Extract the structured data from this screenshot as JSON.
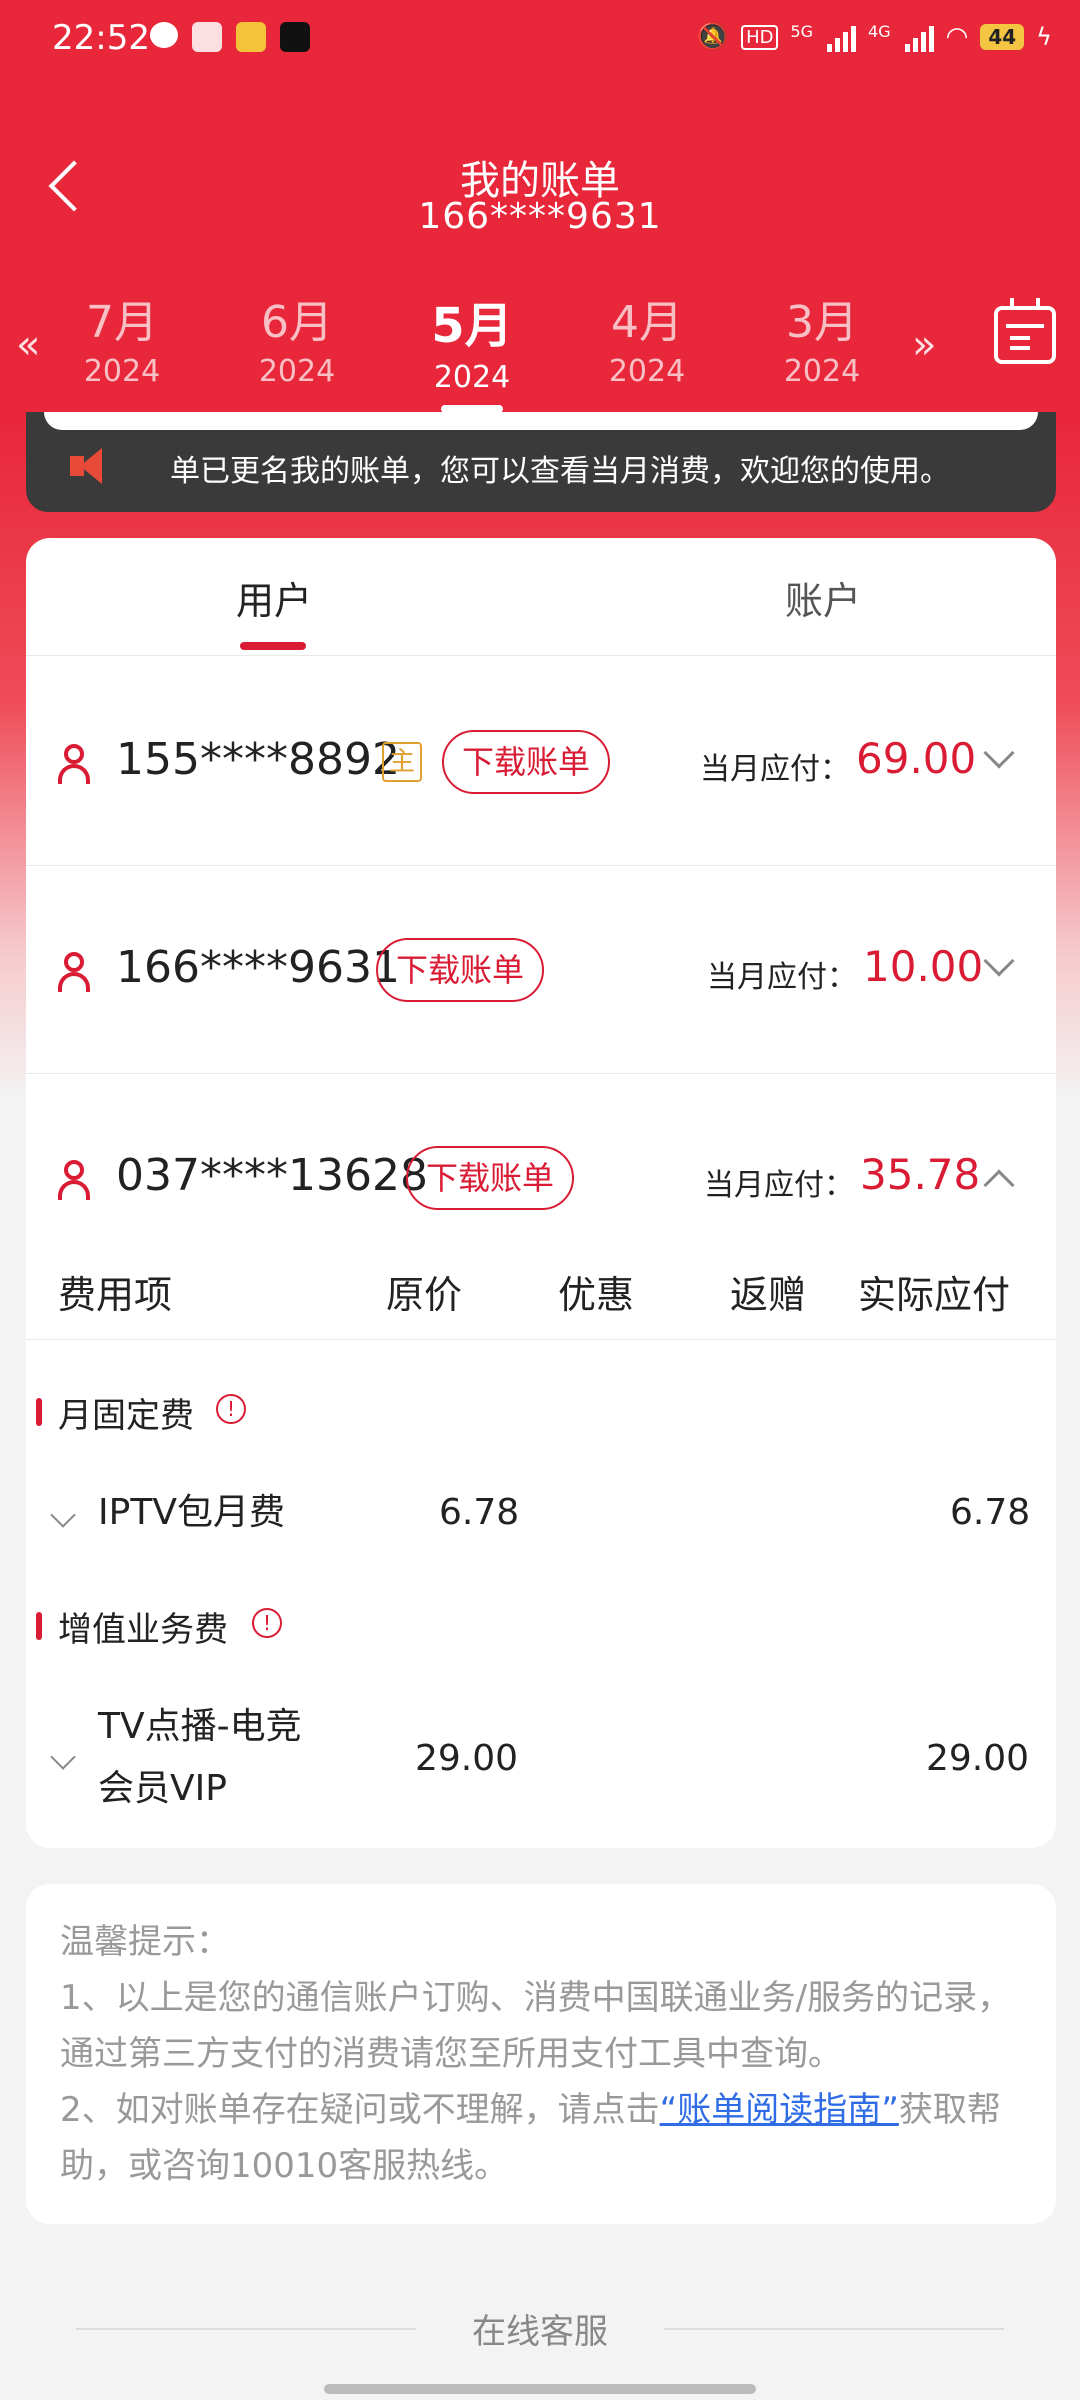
{
  "status_bar": {
    "time": "22:52",
    "signal_5g": "5G",
    "signal_4g": "4G",
    "battery": "44"
  },
  "header": {
    "title": "我的账单",
    "subtitle": "166****9631"
  },
  "months": [
    {
      "month": "7月",
      "year": "2024"
    },
    {
      "month": "6月",
      "year": "2024"
    },
    {
      "month": "5月",
      "year": "2024"
    },
    {
      "month": "4月",
      "year": "2024"
    },
    {
      "month": "3月",
      "year": "2024"
    }
  ],
  "selected_month_index": 2,
  "notice": "单已更名我的账单，您可以查看当月消费，欢迎您的使用。",
  "tabs": [
    "用户",
    "账户"
  ],
  "accounts": [
    {
      "number": "155****8892",
      "badge": "主",
      "download_label": "下载账单",
      "due_label": "当月应付：",
      "due_value": "69.00"
    },
    {
      "number": "166****9631",
      "download_label": "下载账单",
      "due_label": "当月应付：",
      "due_value": "10.00"
    },
    {
      "number": "037****13628",
      "download_label": "下载账单",
      "due_label": "当月应付：",
      "due_value": "35.78"
    }
  ],
  "fee_table": {
    "headers": [
      "费用项",
      "原价",
      "优惠",
      "返赠",
      "实际应付"
    ],
    "sections": [
      {
        "title": "月固定费",
        "rows": [
          {
            "name": "IPTV包月费",
            "price": "6.78",
            "actual": "6.78"
          }
        ]
      },
      {
        "title": "增值业务费",
        "rows": [
          {
            "name_line1": "TV点播-电竞",
            "name_line2": "会员VIP",
            "price": "29.00",
            "actual": "29.00"
          }
        ]
      }
    ]
  },
  "tips": {
    "title": "温馨提示：",
    "line1": "1、以上是您的通信账户订购、消费中国联通业务/服务的记录，通过第三方支付的消费请您至所用支付工具中查询。",
    "line2_prefix": "2、如对账单存在疑问或不理解，请点击",
    "line2_link": "“账单阅读指南”",
    "line2_suffix": "获取帮助，或咨询10010客服热线。"
  },
  "footer": {
    "label": "在线客服"
  },
  "colors": {
    "brand_red": "#d91b34",
    "header_red": "#e8283a",
    "link_blue": "#2f6ce5"
  }
}
